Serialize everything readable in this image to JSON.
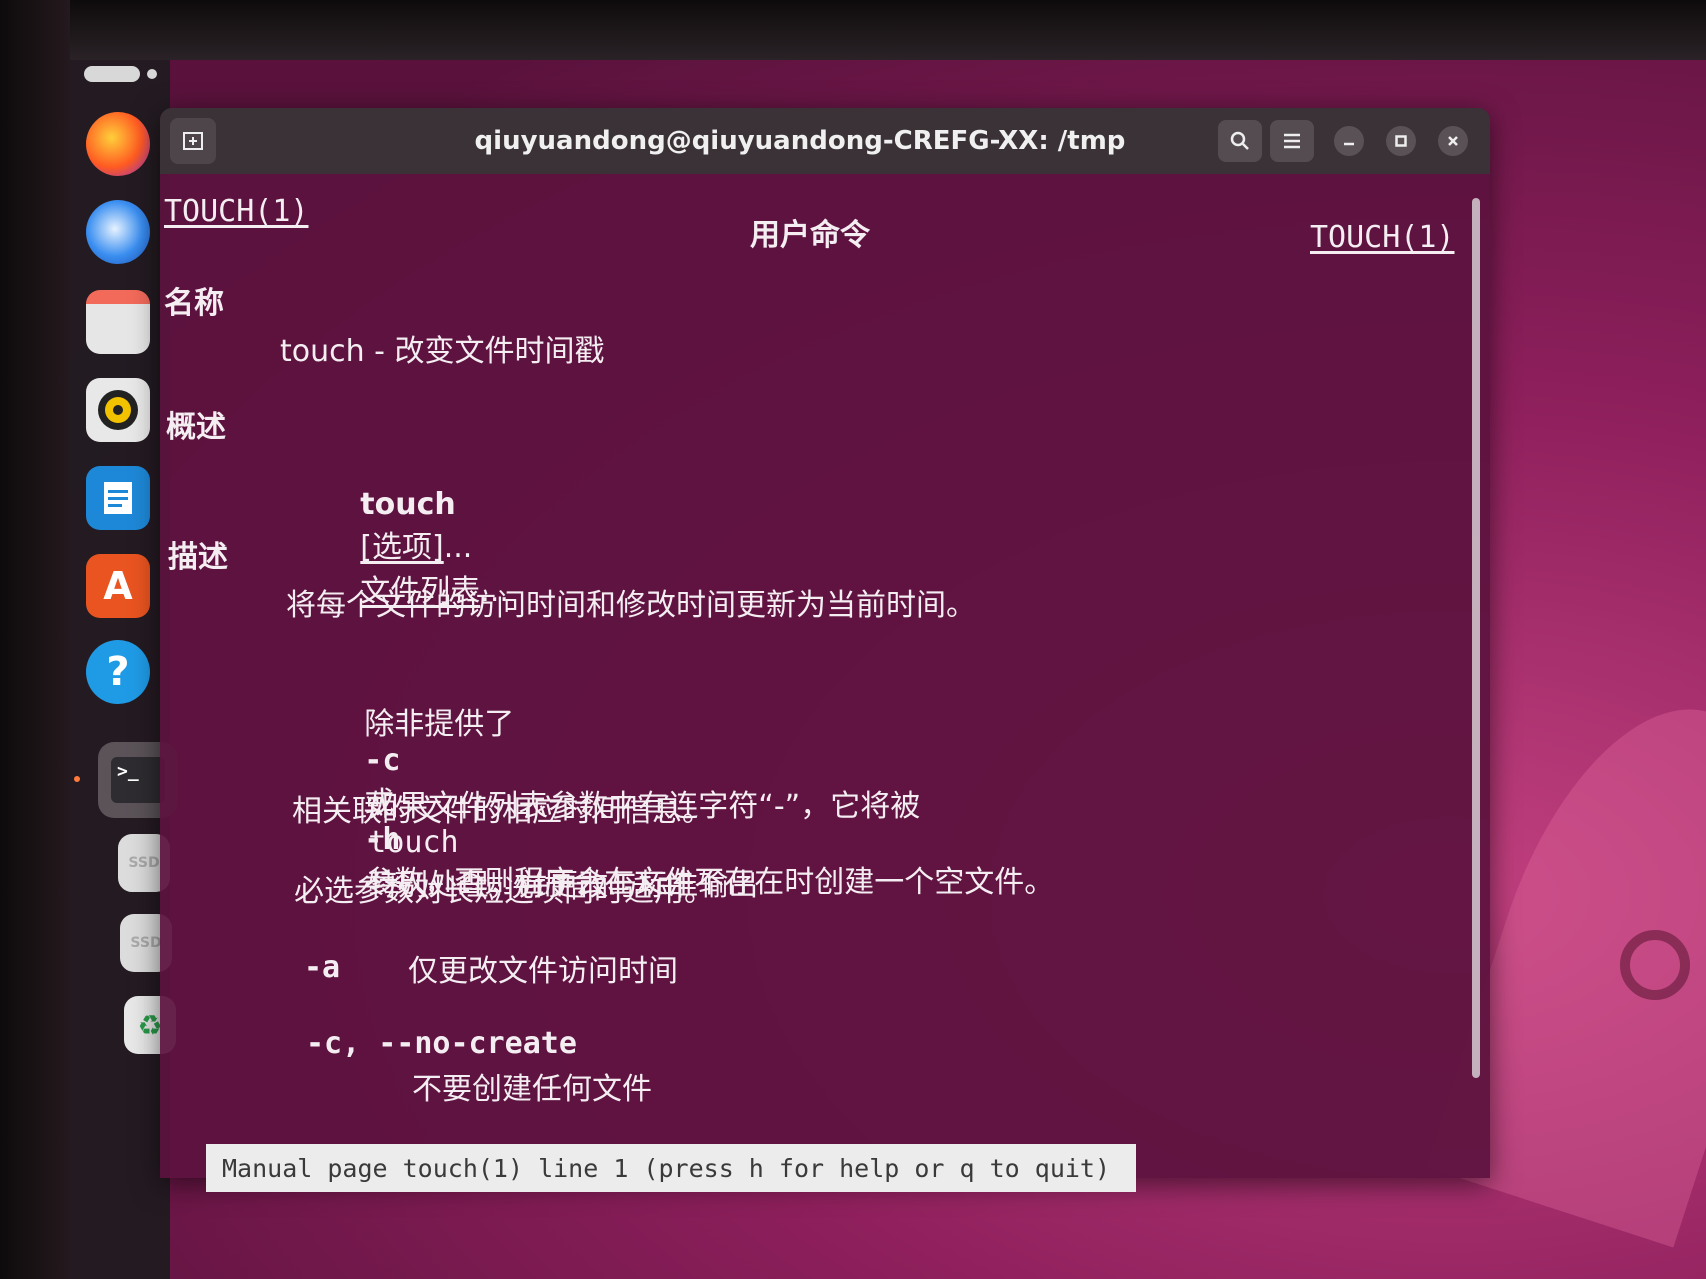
{
  "window": {
    "title": "qiuyuandong@qiuyuandong-CREFG-XX: /tmp"
  },
  "dock": {
    "items": [
      {
        "name": "firefox-icon",
        "color": "#ff6b2c"
      },
      {
        "name": "thunderbird-icon",
        "color": "#2f7fe0"
      },
      {
        "name": "files-icon",
        "color": "#d9d9d9"
      },
      {
        "name": "rhythmbox-icon",
        "color": "#f2c200"
      },
      {
        "name": "writer-icon",
        "color": "#1e88d8"
      },
      {
        "name": "app-center-icon",
        "color": "#e95420"
      },
      {
        "name": "help-icon",
        "glyph": "?",
        "color": "#1f9be6"
      },
      {
        "name": "terminal-icon",
        "glyph": ">_",
        "color": "#4a4a4a"
      },
      {
        "name": "ssd-drive-icon",
        "glyph": "SSD",
        "color": "#dadada"
      },
      {
        "name": "ssd-drive-icon",
        "glyph": "SSD",
        "color": "#dadada"
      },
      {
        "name": "trash-icon",
        "glyph": "♻",
        "color": "#e8e8e8"
      }
    ]
  },
  "man": {
    "header_left": "TOUCH(1)",
    "header_center": "用户命令",
    "header_right": "TOUCH(1)",
    "section_name": "名称",
    "name_line": "touch - 改变文件时间戳",
    "section_synopsis": "概述",
    "synopsis_cmd": "touch",
    "synopsis_opt": "[选项]",
    "synopsis_dots1": "...",
    "synopsis_files": "文件列表",
    "synopsis_dots2": "...",
    "section_desc": "描述",
    "desc_1": "将每个文件的访问时间和修改时间更新为当前时间。",
    "desc_2a": "除非提供了",
    "desc_2_c": "-c",
    "desc_2_or": "或",
    "desc_2_h": "-h",
    "desc_2b": "参数，否则程序会在文件不存在时创建一个空文件。",
    "desc_3a": "如果文件列表参数中有连字符“-”，它将被",
    "desc_3_touch": "touch",
    "desc_3b": "特别处理，并更改与标准输出",
    "desc_3c": "相关联的文件的相应时间信息。",
    "desc_4": "必选参数对长短选项同时适用。",
    "opt_a": "-a",
    "opt_a_desc": "仅更改文件访问时间",
    "opt_c": "-c, --no-create",
    "opt_c_desc": "不要创建任何文件"
  },
  "status": "Manual page touch(1) line 1 (press h for help or q to quit)"
}
